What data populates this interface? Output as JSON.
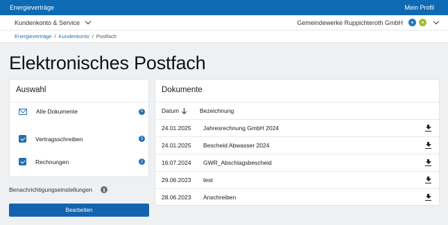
{
  "topbar": {
    "brand": "Energieverträge",
    "profile": "Mein Profil"
  },
  "subbar": {
    "menu": "Kundenkonto & Service",
    "company": "Gemeindewerke Ruppichteroth GmbH"
  },
  "breadcrumb": {
    "items": [
      "Energieverträge",
      "Kundenkonto",
      "Postfach"
    ],
    "separator": "/"
  },
  "page": {
    "title": "Elektronisches Postfach"
  },
  "auswahl": {
    "title": "Auswahl",
    "items": [
      {
        "label": "Alle Dokumente",
        "count": "5",
        "icon": "mail-icon"
      },
      {
        "label": "Vertragsschreiben",
        "count": "3",
        "icon": "checkbox"
      },
      {
        "label": "Rechnungen",
        "count": "2",
        "icon": "checkbox"
      }
    ]
  },
  "notifications": {
    "label": "Benachrichtigungseinstellungen",
    "info": "i",
    "button": "Bearbeiten"
  },
  "dokumente": {
    "title": "Dokumente",
    "columns": {
      "date": "Datum",
      "name": "Bezeichnung"
    },
    "rows": [
      {
        "date": "24.01.2025",
        "name": "Jahresrechnung GmbH 2024"
      },
      {
        "date": "24.01.2025",
        "name": "Bescheid Abwasser 2024"
      },
      {
        "date": "16.07.2024",
        "name": "GWR_Abschlagsbescheid"
      },
      {
        "date": "29.06.2023",
        "name": "test"
      },
      {
        "date": "28.06.2023",
        "name": "Anschreiben"
      }
    ]
  },
  "colors": {
    "primary": "#0f6ab4",
    "button": "#1463b0",
    "accent_green": "#9cc22e"
  }
}
